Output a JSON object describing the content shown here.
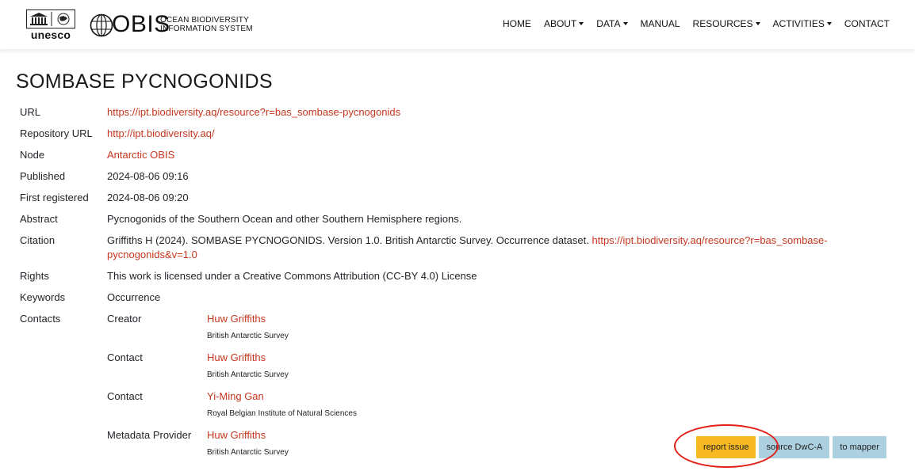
{
  "header": {
    "unesco_logo_text": "unesco",
    "obis_logo_text": "OBIS",
    "obis_subtitle_line1": "OCEAN BIODIVERSITY",
    "obis_subtitle_line2": "INFORMATION SYSTEM",
    "nav": {
      "home": "HOME",
      "about": "ABOUT",
      "data": "DATA",
      "manual": "MANUAL",
      "resources": "RESOURCES",
      "activities": "ACTIVITIES",
      "contact": "CONTACT"
    }
  },
  "page_title": "SOMBASE PYCNOGONIDS",
  "metadata": {
    "url_label": "URL",
    "url_value": "https://ipt.biodiversity.aq/resource?r=bas_sombase-pycnogonids",
    "repo_label": "Repository URL",
    "repo_value": "http://ipt.biodiversity.aq/",
    "node_label": "Node",
    "node_value": "Antarctic OBIS",
    "published_label": "Published",
    "published_value": "2024-08-06 09:16",
    "first_registered_label": "First registered",
    "first_registered_value": "2024-08-06 09:20",
    "abstract_label": "Abstract",
    "abstract_value": "Pycnogonids of the Southern Ocean and other Southern Hemisphere regions.",
    "citation_label": "Citation",
    "citation_text": "Griffiths H (2024). SOMBASE PYCNOGONIDS. Version 1.0. British Antarctic Survey. Occurrence dataset.",
    "citation_link_line1": "https://ipt.biodiversity.aq/resource?r=bas_sombase-",
    "citation_link_line2": "pycnogonids&v=1.0",
    "rights_label": "Rights",
    "rights_value": "This work is licensed under a Creative Commons Attribution (CC-BY 4.0) License",
    "keywords_label": "Keywords",
    "keywords_value": "Occurrence",
    "contacts_label": "Contacts"
  },
  "contacts": [
    {
      "role": "Creator",
      "name": "Huw Griffiths",
      "org": "British Antarctic Survey"
    },
    {
      "role": "Contact",
      "name": "Huw Griffiths",
      "org": "British Antarctic Survey"
    },
    {
      "role": "Contact",
      "name": "Yi-Ming Gan",
      "org": "Royal Belgian Institute of Natural Sciences"
    },
    {
      "role": "Metadata Provider",
      "name": "Huw Griffiths",
      "org": "British Antarctic Survey"
    }
  ],
  "buttons": {
    "report_issue": "report issue",
    "source_dwca": "source DwC-A",
    "to_mapper": "to mapper"
  },
  "colors": {
    "link": "#c7361e",
    "warning_button": "#f6b922",
    "info_button": "#acd0e0",
    "annotation_circle": "#e32018"
  }
}
